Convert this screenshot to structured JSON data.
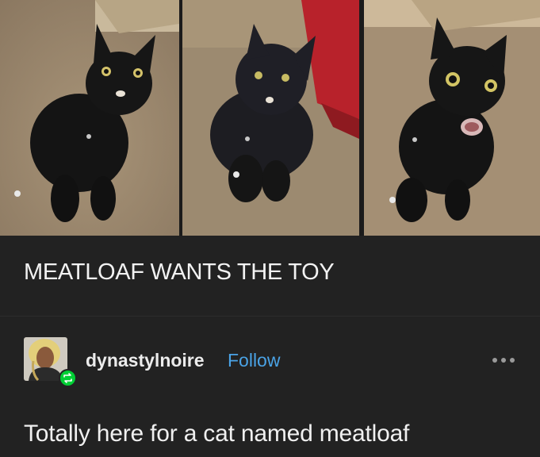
{
  "post": {
    "photos": [
      {
        "icon": "black-cat-photo"
      },
      {
        "icon": "black-cat-photo"
      },
      {
        "icon": "black-cat-photo"
      }
    ],
    "caption": "MEATLOAF WANTS THE TOY"
  },
  "reblog": {
    "username": "dynastylnoire",
    "follow_label": "Follow",
    "more_icon": "ellipsis-icon",
    "reblog_icon": "reblog-icon",
    "text": "Totally here for a cat named meatloaf"
  },
  "colors": {
    "background": "#222222",
    "follow": "#4aa3e6",
    "reblog_badge": "#00cf35"
  }
}
